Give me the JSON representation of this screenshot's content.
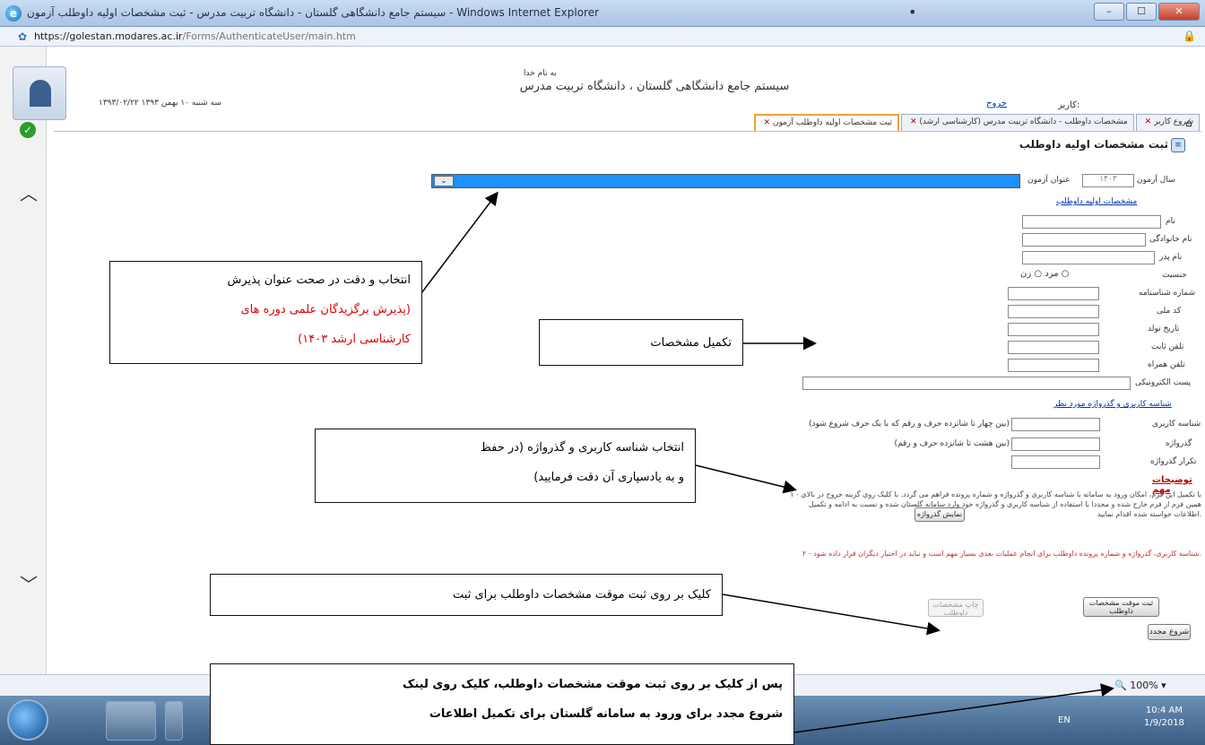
{
  "window": {
    "title": "سیستم جامع دانشگاهی گلستان - دانشگاه تربیت مدرس - ثبت مشخصات اولیه داوطلب آزمون - Windows Internet Explorer",
    "url_host": "https://golestan.modares.ac.ir",
    "url_path": "/Forms/AuthenticateUser/main.htm",
    "buttons": [
      "–",
      "☐",
      "✕"
    ]
  },
  "header": {
    "date_text": "۱۳۹۳/۰۲/۲۲ سه شنبه ۱۰ بهمن ۱۳۹۳",
    "system_small": "به نام خدا",
    "system_title": "سیستم جامع دانشگاهی گلستان ، دانشگاه تربیت مدرس",
    "user_label": "کاربر:",
    "user_link": "خروج"
  },
  "tabs": [
    {
      "label": "شروع کاربر",
      "active": false
    },
    {
      "label": "مشخصات داوطلب - دانشگاه تربیت مدرس (کارشناسی ارشد)",
      "active": false
    },
    {
      "label": "ثبت مشخصات اولیه داوطلب آزمون",
      "active": true
    }
  ],
  "form": {
    "title": "ثبت مشخصات اولیه داوطلب",
    "exam_year_label": "سال آزمون",
    "exam_year_value": "۱۴۰۳",
    "exam_title_label": "عنوان آزمون",
    "section_personal": "مشخصات اولیه داوطلب",
    "fields": [
      "نام",
      "نام خانوادگی",
      "نام پدر",
      "جنسیت",
      "شماره شناسنامه",
      "کد ملی",
      "تاریخ تولد",
      "تلفن ثابت",
      "تلفن همراه",
      "پست الکترونیکی"
    ],
    "gender_options": "مرد ○   زن ○",
    "section_account": "شناسه کاربری و گذرواژه مورد نظر",
    "account_fields": [
      "شناسه کاربری",
      "گذرواژه",
      "تکرار گذرواژه"
    ],
    "username_hint": "(بین چهار تا شانزده حرف و رقم که با یک حرف شروع شود)",
    "password_hint": "(بین هشت تا شانزده حرف و رقم)",
    "notes_title": "توضیحات مهم",
    "note_1": "۱ - با تکمیل این فرم، امکان ورود به سامانه با شناسه کاربری و گذرواژه و شماره پرونده فراهم می گردد. با کلیک روی گزینه خروج در بالای همین فرم از فرم خارج شده و مجددا با استفاده از شناسه کاربری و گذرواژه خود وارد سامانه گلستان شده و نسبت به ادامه و تکمیل اطلاعات خواسته شده اقدام نمایید.",
    "note_2": "۲ - شناسه کاربری، گذرواژه و شماره پرونده داوطلب برای انجام عملیات بعدی بسیار مهم است و نباید در اختیار دیگران قرار داده شود.",
    "btn_show_password": "نمایش گذرواژه",
    "btn_temp_save": "ثبت موقت مشخصات داوطلب",
    "btn_print": "چاپ مشخصات داوطلب",
    "btn_restart": "شروع مجدد"
  },
  "statusbar": {
    "zoom": "100%"
  },
  "taskbar": {
    "lang": "EN",
    "time": "10:4 AM",
    "date": "1/9/2018"
  },
  "callouts": {
    "select_exam": {
      "line1": "انتخاب و دقت در صحت عنوان پذیرش",
      "line2": "(پذیرش برگزیدگان علمی دوره های",
      "line3": "کارشناسی ارشد ۱۴۰۳)"
    },
    "complete_info": "تکمیل مشخصات",
    "choose_credentials": {
      "line1": "انتخاب شناسه کاربری و گذرواژه (در حفظ",
      "line2": "و به یادسپاری آن دقت فرمایید)"
    },
    "click_temp_save": "کلیک بر روی ثبت موقت مشخصات داوطلب برای ثبت",
    "after_save": {
      "line1": "پس از کلیک بر روی ثبت موقت مشخصات داوطلب، کلیک روی لینک",
      "line2": "شروع مجدد برای ورود به سامانه گلستان برای تکمیل اطلاعات"
    }
  },
  "colors": {
    "accent_red": "#e00000",
    "select_blue": "#1e90ff",
    "link_blue": "#0033aa"
  }
}
